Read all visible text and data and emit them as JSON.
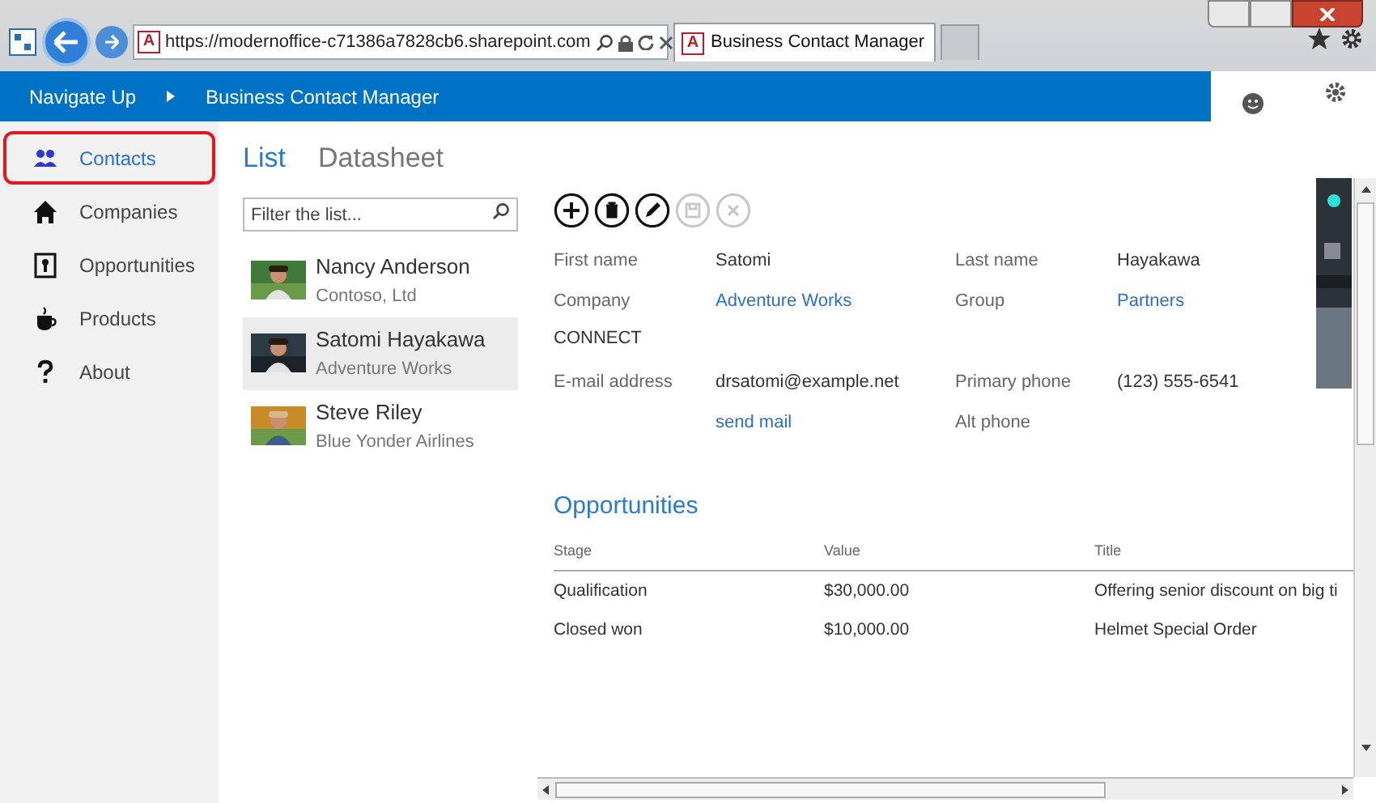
{
  "browser": {
    "address_icon": "A",
    "address": "https://modernoffice-c71386a7828cb6.sharepoint.com",
    "tab_icon": "A",
    "tab_title": "Business Contact Manager"
  },
  "header": {
    "breadcrumbs": [
      "Navigate Up",
      "Business Contact Manager"
    ]
  },
  "sidebar": {
    "items": [
      {
        "label": "Contacts",
        "kind": "people",
        "selected": true
      },
      {
        "label": "Companies",
        "kind": "home",
        "selected": false
      },
      {
        "label": "Opportunities",
        "kind": "keyhole",
        "selected": false
      },
      {
        "label": "Products",
        "kind": "cup",
        "selected": false
      },
      {
        "label": "About",
        "kind": "question",
        "selected": false
      }
    ]
  },
  "views": [
    {
      "label": "List",
      "selected": true
    },
    {
      "label": "Datasheet",
      "selected": false
    }
  ],
  "filter": {
    "placeholder": "Filter the list..."
  },
  "contacts": [
    {
      "name": "Nancy Anderson",
      "company": "Contoso, Ltd",
      "selected": false
    },
    {
      "name": "Satomi Hayakawa",
      "company": "Adventure Works",
      "selected": true
    },
    {
      "name": "Steve Riley",
      "company": "Blue Yonder Airlines",
      "selected": false
    }
  ],
  "actions": [
    {
      "kind": "add",
      "disabled": false
    },
    {
      "kind": "delete",
      "disabled": false
    },
    {
      "kind": "edit",
      "disabled": false
    },
    {
      "kind": "save",
      "disabled": true
    },
    {
      "kind": "cancel",
      "disabled": true
    }
  ],
  "form": {
    "rows": [
      {
        "kind": "pair",
        "label": "First name",
        "value": "Satomi",
        "label2": "Last name",
        "value2": "Hayakawa"
      },
      {
        "kind": "links",
        "label": "Company",
        "value": "Adventure Works",
        "label2": "Group",
        "value2": "Partners"
      },
      {
        "kind": "section",
        "label": "CONNECT"
      },
      {
        "kind": "pair",
        "label": "E-mail address",
        "value": "drsatomi@example.net",
        "label2": "Primary phone",
        "value2": "(123) 555-6541"
      },
      {
        "kind": "action",
        "value": "send mail",
        "label2": "Alt phone"
      }
    ]
  },
  "opportunities": {
    "title": "Opportunities",
    "columns": [
      "Stage",
      "Value",
      "Title"
    ],
    "rows": [
      [
        "Qualification",
        "$30,000.00",
        "Offering senior discount on big ti"
      ],
      [
        "Closed won",
        "$10,000.00",
        "Helmet Special Order"
      ]
    ]
  }
}
